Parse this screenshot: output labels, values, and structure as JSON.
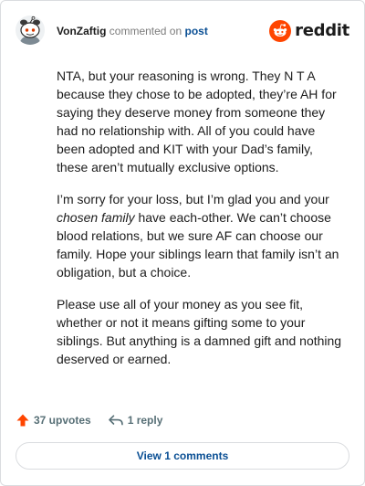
{
  "header": {
    "username": "VonZaftig",
    "action": "commented on",
    "post_link": "post",
    "brand": "reddit",
    "brand_color": "#ff4500",
    "link_color": "#0a4f94"
  },
  "comment": {
    "p1": "NTA, but your reasoning is wrong. They N T A because they chose to be adopted, they’re AH for saying they deserve money from someone they had no relationship with. All of you could have been adopted and KIT with your Dad’s family, these aren’t mutually exclusive options.",
    "p2_before": "I’m sorry for your loss, but I’m glad you and your ",
    "p2_em": "chosen family",
    "p2_after": " have each-other. We can’t choose blood relations, but we sure AF can choose our family. Hope your siblings learn that family isn’t an obligation, but a choice.",
    "p3": "Please use all of your money as you see fit, whether or not it means gifting some to your siblings. But anything is a damned gift and nothing deserved or earned."
  },
  "footer": {
    "upvotes": "37 upvotes",
    "replies": "1 reply",
    "upvote_icon": "upvote-arrow-icon",
    "reply_icon": "reply-arrow-icon"
  },
  "view_comments": {
    "label": "View 1 comments"
  }
}
